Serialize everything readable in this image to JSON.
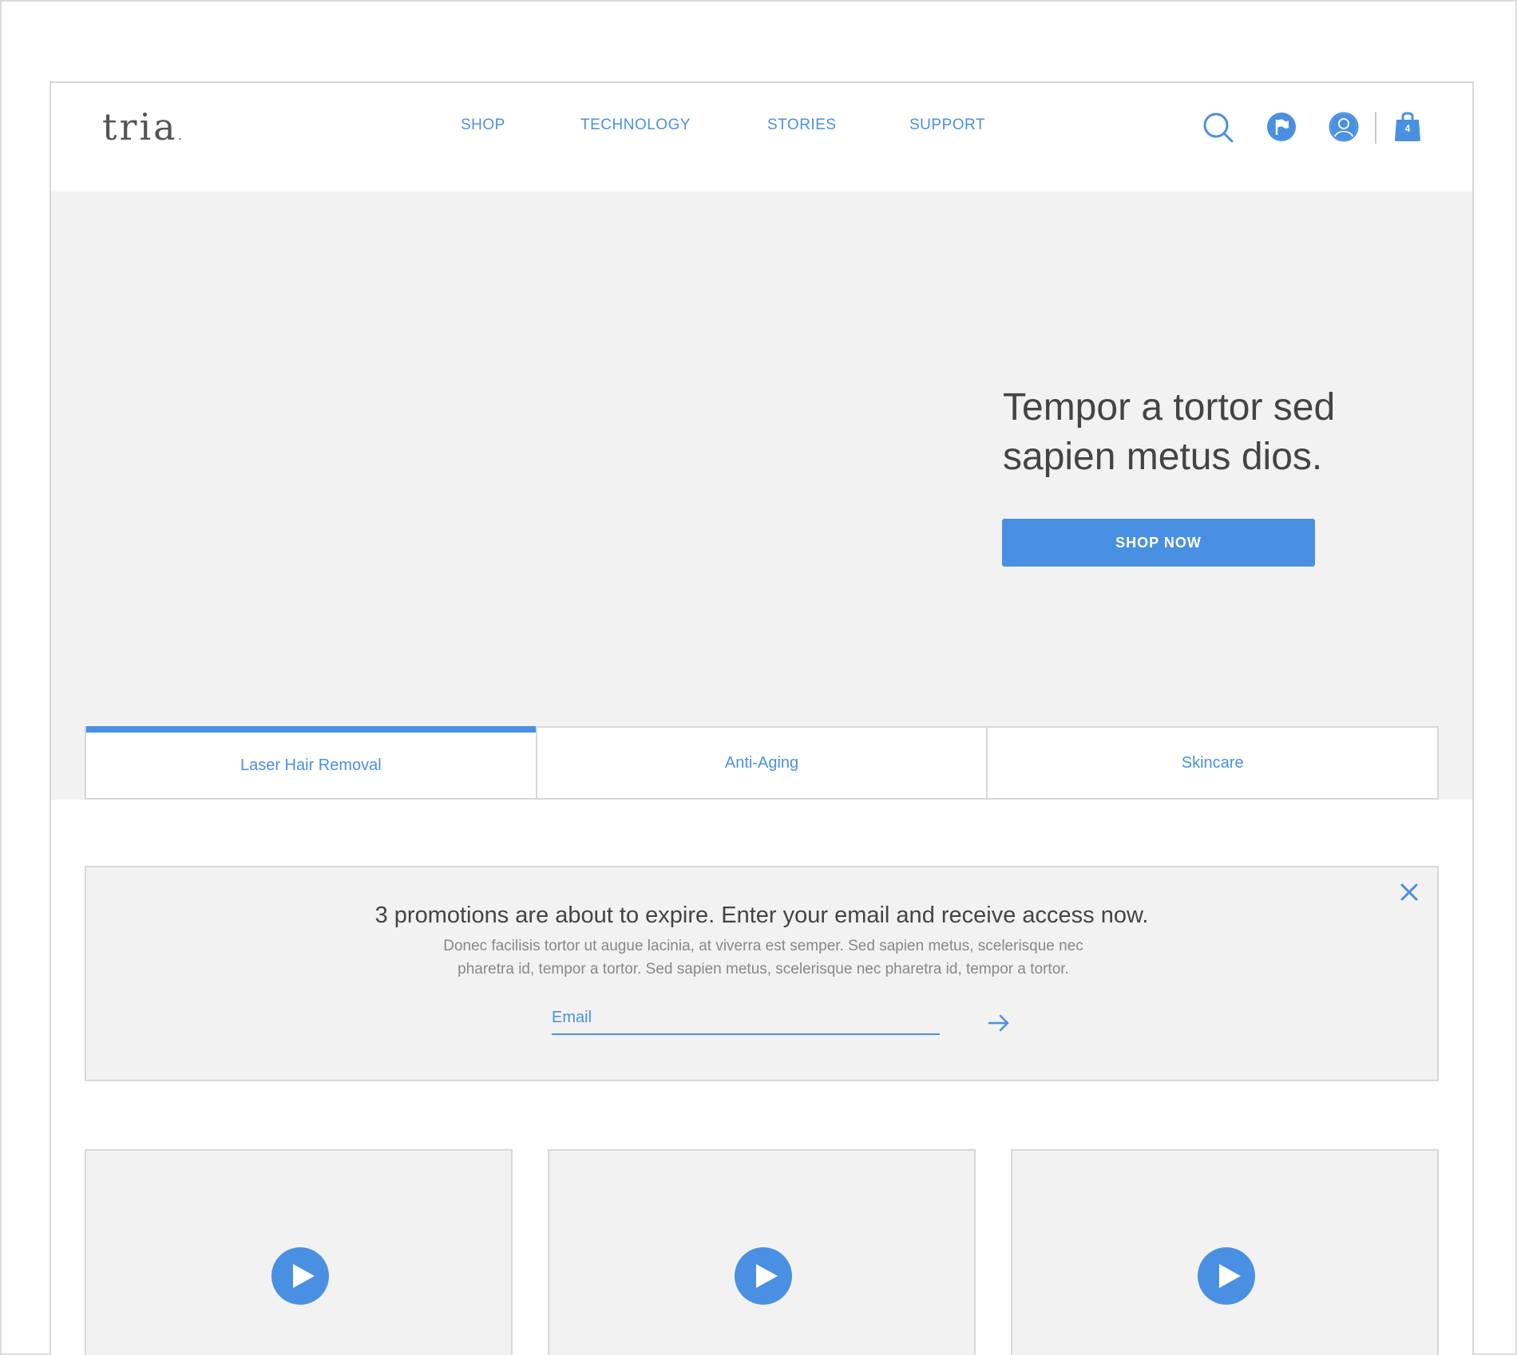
{
  "brand": {
    "logo_text": "tria",
    "logo_dot": "."
  },
  "nav": {
    "items": [
      {
        "label": "SHOP"
      },
      {
        "label": "TECHNOLOGY"
      },
      {
        "label": "STORIES"
      },
      {
        "label": "SUPPORT"
      }
    ]
  },
  "header_icons": {
    "search": "search-icon",
    "region": "flag-icon",
    "account": "user-icon",
    "cart": "shopping-bag-icon",
    "cart_count": "4"
  },
  "hero": {
    "title_line1": "Tempor a tortor sed",
    "title_line2": "sapien metus dios.",
    "cta_label": "SHOP NOW"
  },
  "tabs": [
    {
      "label": "Laser Hair Removal",
      "active": true
    },
    {
      "label": "Anti-Aging",
      "active": false
    },
    {
      "label": "Skincare",
      "active": false
    }
  ],
  "promo": {
    "heading": "3 promotions are about to expire. Enter your email and receive access now.",
    "body_line1": "Donec facilisis tortor ut augue lacinia, at viverra est semper. Sed sapien metus, scelerisque nec",
    "body_line2": "pharetra id, tempor a tortor. Sed sapien metus, scelerisque nec pharetra id, tempor a tortor.",
    "email_placeholder": "Email",
    "close_icon": "close-icon",
    "submit_icon": "arrow-right-icon"
  },
  "video_cards": [
    {
      "icon": "play-icon"
    },
    {
      "icon": "play-icon"
    },
    {
      "icon": "play-icon"
    }
  ],
  "colors": {
    "accent": "#4a90e2",
    "panel_bg": "#f2f2f2",
    "border": "#d8d8d8",
    "text_dark": "#444444",
    "text_muted": "#888888"
  }
}
